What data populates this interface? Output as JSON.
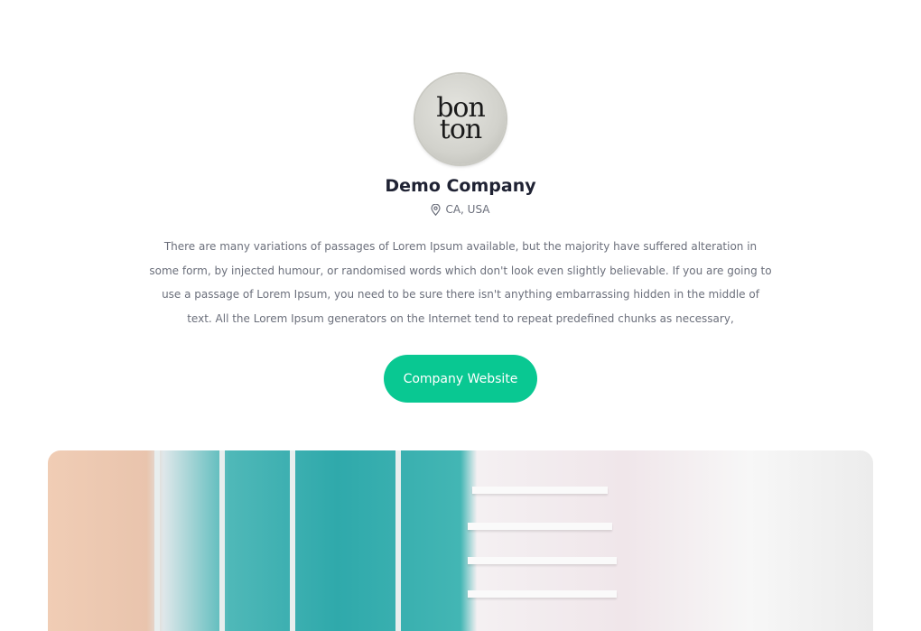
{
  "company": {
    "logo_text": [
      "bon",
      "ton"
    ],
    "name": "Demo Company",
    "location": "CA, USA",
    "location_icon": "map-pin-icon",
    "description": "There are many variations of passages of Lorem Ipsum available, but the majority have suffered alteration in some form, by injected humour, or randomised words which don't look even slightly believable. If you are going to use a passage of Lorem Ipsum, you need to be sure there isn't anything embarrassing hidden in the middle of text. All the Lorem Ipsum generators on the Internet tend to repeat predefined chunks as necessary,",
    "website_label": "Company Website"
  },
  "colors": {
    "accent": "#09c892",
    "heading": "#1f2233",
    "muted": "#6b6f7b"
  }
}
